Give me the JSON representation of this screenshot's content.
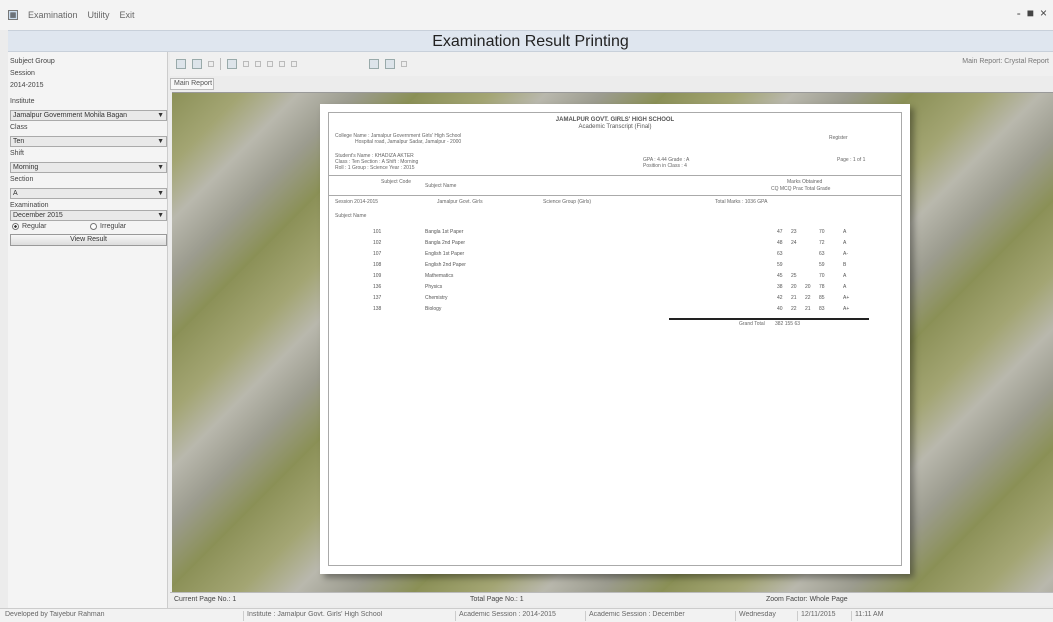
{
  "window": {
    "title": "Examination Result Printing",
    "menus": [
      "Examination",
      "Utility",
      "Exit"
    ],
    "controls": [
      "-",
      "■",
      "×"
    ]
  },
  "left_panel": {
    "labels": [
      "Subject Group",
      "Session",
      "2014-2015",
      "Institute",
      "Jamalpur Government Mohila Bagan",
      "Class",
      "Ten"
    ],
    "institute_combo": "Jamalpur Government Mohila Bagan",
    "class_label": "Class",
    "class_combo": "Ten",
    "shift_label": "Shift",
    "shift_combo": "Morning",
    "section_label": "Section",
    "section_combo": "A",
    "exam_label": "Examination",
    "exam_combo": "December 2015",
    "radio_regular": "Regular",
    "radio_irregular": "Irregular",
    "view_button": "View Result"
  },
  "toolbar": {
    "right_text": "Main Report: Crystal Report"
  },
  "tabs": {
    "main": "Main Report"
  },
  "report": {
    "institute_name": "JAMALPUR GOVT. GIRLS' HIGH SCHOOL",
    "exam_title": "Academic Transcript (Final)",
    "school_line": "College Name : Jamalpur Government Girls' High School",
    "school_line2": "Hospital road, Jamalpur Sadar, Jamalpur - 2000",
    "reg_label": "Register",
    "student_line": "Student's Name : KHADIZA AKTER",
    "student_line2": "Class : Ten   Section : A   Shift : Morning",
    "student_line3": "Roll : 1   Group : Science   Year : 2015",
    "grade_info": "GPA : 4.44   Grade : A",
    "grade_info2": "Position in Class : 4",
    "page_label": "Page : 1 of 1",
    "col_subject_code": "Subject Code",
    "col_subject_name": "Subject Name",
    "col_marks": "Marks Obtained",
    "col_marks_sub": "CQ   MCQ   Prac   Total   Grade",
    "group_label": "Session 2014-2015",
    "group_value": "Jamalpur Govt. Girls",
    "group_value2": "Science Group (Girls)",
    "group_value3": "Total Marks : 1036 GPA",
    "section_label": "Subject Name",
    "subjects": [
      {
        "code": "101",
        "name": "Bangla 1st Paper",
        "cq": "47",
        "mcq": "23",
        "prac": "",
        "total": "70",
        "grade": "A"
      },
      {
        "code": "102",
        "name": "Bangla 2nd Paper",
        "cq": "48",
        "mcq": "24",
        "prac": "",
        "total": "72",
        "grade": "A"
      },
      {
        "code": "107",
        "name": "English 1st Paper",
        "cq": "63",
        "mcq": "",
        "prac": "",
        "total": "63",
        "grade": "A-"
      },
      {
        "code": "108",
        "name": "English 2nd Paper",
        "cq": "59",
        "mcq": "",
        "prac": "",
        "total": "59",
        "grade": "B"
      },
      {
        "code": "109",
        "name": "Mathematics",
        "cq": "45",
        "mcq": "25",
        "prac": "",
        "total": "70",
        "grade": "A"
      },
      {
        "code": "136",
        "name": "Physics",
        "cq": "38",
        "mcq": "20",
        "prac": "20",
        "total": "78",
        "grade": "A"
      },
      {
        "code": "137",
        "name": "Chemistry",
        "cq": "42",
        "mcq": "21",
        "prac": "22",
        "total": "85",
        "grade": "A+"
      },
      {
        "code": "138",
        "name": "Biology",
        "cq": "40",
        "mcq": "22",
        "prac": "21",
        "total": "83",
        "grade": "A+"
      }
    ],
    "total_label": "Grand Total",
    "total_values": "382  155  63"
  },
  "page_status": {
    "current_page": "Current Page No.: 1",
    "total_page": "Total Page No.: 1",
    "zoom": "Zoom Factor: Whole Page"
  },
  "status_bar": {
    "left": "Developed by Taiyebur Rahman",
    "cell1": "Institute : Jamalpur Govt. Girls' High School",
    "cell2": "Academic Session : 2014-2015",
    "cell3": "Academic Session : December",
    "cell4": "Wednesday",
    "cell5": "12/11/2015",
    "cell6": "11:11 AM"
  },
  "colors": {
    "title_bg": "#dfe6ef",
    "preview_bg": "#8c9158"
  }
}
